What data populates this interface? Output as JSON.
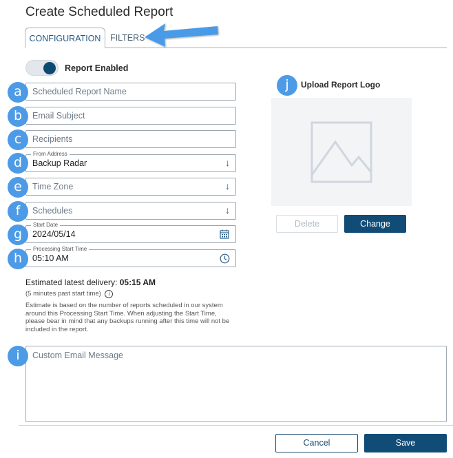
{
  "dialog": {
    "title": "Create Scheduled Report"
  },
  "tabs": [
    {
      "label": "CONFIGURATION",
      "active": true
    },
    {
      "label": "FILTERS",
      "active": false
    }
  ],
  "report_enabled": {
    "label": "Report Enabled",
    "on": true
  },
  "fields": {
    "name": {
      "badge": "a",
      "placeholder": "Scheduled Report Name"
    },
    "subject": {
      "badge": "b",
      "placeholder": "Email Subject"
    },
    "recipients": {
      "badge": "c",
      "placeholder": "Recipients"
    },
    "from_address": {
      "badge": "d",
      "label": "From Address",
      "value": "Backup Radar"
    },
    "time_zone": {
      "badge": "e",
      "placeholder": "Time Zone"
    },
    "schedules": {
      "badge": "f",
      "placeholder": "Schedules"
    },
    "start_date": {
      "badge": "g",
      "label": "Start Date",
      "value": "2024/05/14"
    },
    "processing_start_time": {
      "badge": "h",
      "label": "Processing Start Time",
      "value": "05:10 AM"
    },
    "custom_message": {
      "badge": "i",
      "placeholder": "Custom Email Message"
    }
  },
  "estimate": {
    "label": "Estimated latest delivery:",
    "value": "05:15 AM",
    "sub": "(5 minutes past start time)",
    "note": "Estimate is based on the number of reports scheduled in our system around this Processing Start Time. When adjusting the Start Time, please bear in mind that any backups running after this time will not be included in the report."
  },
  "logo": {
    "badge": "j",
    "title": "Upload Report Logo",
    "delete_label": "Delete",
    "change_label": "Change"
  },
  "footer": {
    "cancel_label": "Cancel",
    "save_label": "Save"
  },
  "colors": {
    "accent": "#114c77",
    "badge": "#4d9be6",
    "annotation_arrow": "#4a9be8"
  },
  "icons": {
    "dropdown": "arrow-down-icon",
    "calendar": "calendar-icon",
    "clock": "clock-icon",
    "info": "info-icon",
    "image_placeholder": "image-placeholder-icon"
  }
}
